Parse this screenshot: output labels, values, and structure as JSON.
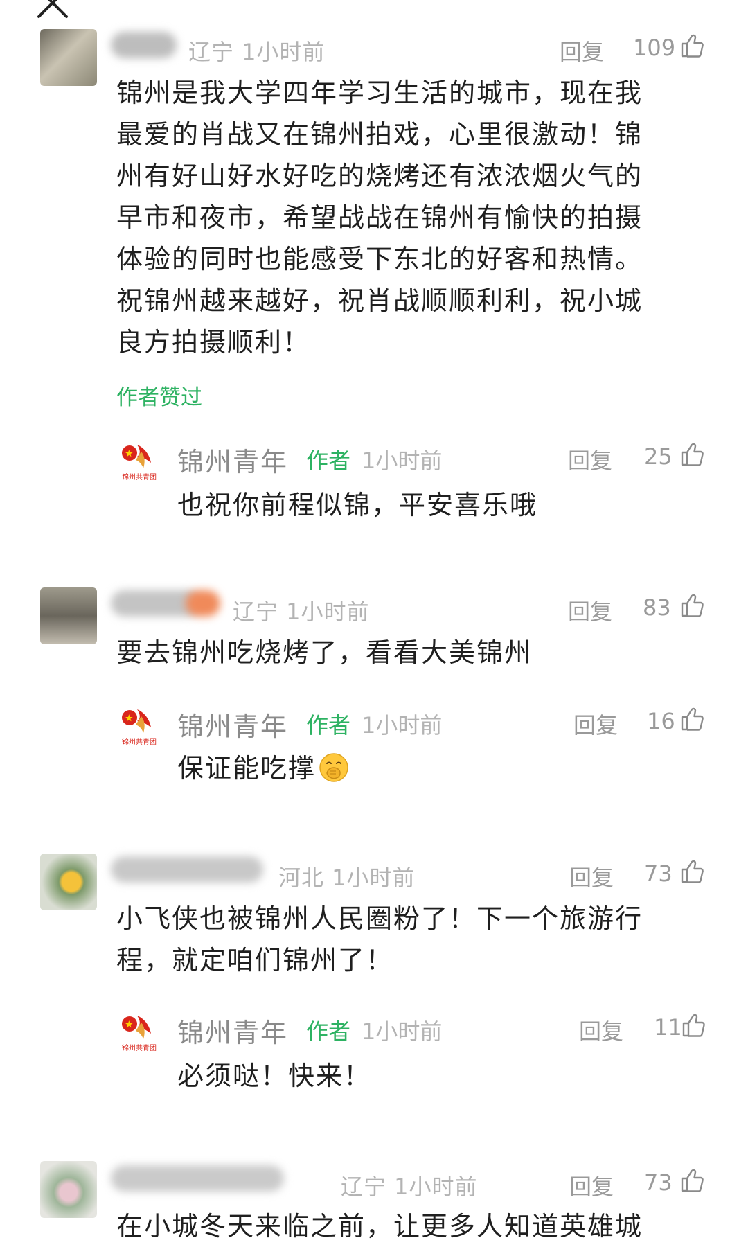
{
  "top": {
    "close_icon": "close-icon"
  },
  "reply_label": "回复",
  "author_liked_label": "作者赞过",
  "official": {
    "name": "锦州青年",
    "author_tag": "作者",
    "time": "1小时前",
    "logo": "youth-league-logo-icon"
  },
  "comments": [
    {
      "meta": "辽宁 1小时前",
      "likes": "109",
      "text": "锦州是我大学四年学习生活的城市，现在我最爱的肖战又在锦州拍戏，心里很激动！锦州有好山好水好吃的烧烤还有浓浓烟火气的早市和夜市，希望战战在锦州有愉快的拍摄体验的同时也能感受下东北的好客和热情。祝锦州越来越好，祝肖战顺顺利利，祝小城良方拍摄顺利！",
      "lines": [
        "锦州是我大学四年学习生活的城市，现在我",
        "最爱的肖战又在锦州拍戏，心里很激动！锦",
        "州有好山好水好吃的烧烤还有浓浓烟火气的",
        "早市和夜市，希望战战在锦州有愉快的拍摄",
        "体验的同时也能感受下东北的好客和热情。",
        "祝锦州越来越好，祝肖战顺顺利利，祝小城",
        "良方拍摄顺利！"
      ],
      "reply": {
        "likes": "25",
        "text": "也祝你前程似锦，平安喜乐哦"
      }
    },
    {
      "meta": "辽宁 1小时前",
      "likes": "83",
      "text": "要去锦州吃烧烤了，看看大美锦州",
      "reply": {
        "likes": "16",
        "text": "保证能吃撑",
        "emoji": "hand-over-mouth-emoji"
      }
    },
    {
      "meta": "河北 1小时前",
      "likes": "73",
      "lines": [
        "小飞侠也被锦州人民圈粉了！下一个旅游行",
        "程，就定咱们锦州了！"
      ],
      "reply": {
        "likes": "11",
        "text": "必须哒！快来！"
      }
    },
    {
      "meta": "辽宁 1小时前",
      "likes": "73",
      "lines": [
        "在小城冬天来临之前，让更多人知道英雄城"
      ]
    }
  ],
  "colors": {
    "text": "#1f1f1f",
    "meta": "#b3b3b3",
    "action": "#9a9a9a",
    "green": "#2db262",
    "logo_red": "#d9261c"
  }
}
